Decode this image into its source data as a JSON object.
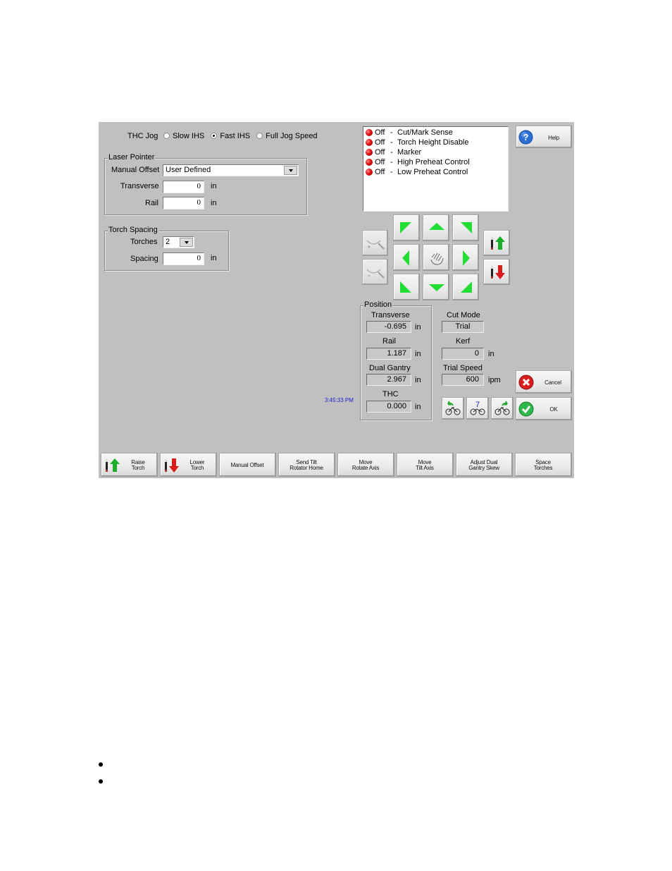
{
  "thc_jog": {
    "label": "THC Jog",
    "options": [
      {
        "label": "Slow IHS",
        "selected": false
      },
      {
        "label": "Fast IHS",
        "selected": true
      },
      {
        "label": "Full Jog Speed",
        "selected": false
      }
    ]
  },
  "laser_pointer": {
    "title": "Laser Pointer",
    "manual_offset_label": "Manual Offset",
    "manual_offset_value": "User Defined",
    "transverse_label": "Transverse",
    "transverse_value": "0",
    "transverse_unit": "in",
    "rail_label": "Rail",
    "rail_value": "0",
    "rail_unit": "in"
  },
  "torch_spacing": {
    "title": "Torch Spacing",
    "torches_label": "Torches",
    "torches_value": "2",
    "spacing_label": "Spacing",
    "spacing_value": "0",
    "spacing_unit": "in"
  },
  "status_list": [
    {
      "state": "Off",
      "sep": "-",
      "name": "Cut/Mark Sense",
      "led_color": "#e01010"
    },
    {
      "state": "Off",
      "sep": "-",
      "name": "Torch Height Disable",
      "led_color": "#e01010"
    },
    {
      "state": "Off",
      "sep": "-",
      "name": "Marker",
      "led_color": "#e01010"
    },
    {
      "state": "Off",
      "sep": "-",
      "name": "High Preheat Control",
      "led_color": "#e01010"
    },
    {
      "state": "Off",
      "sep": "-",
      "name": "Low Preheat Control",
      "led_color": "#e01010"
    }
  ],
  "help_button": {
    "label": "Help",
    "icon": "question-icon"
  },
  "cancel_button": {
    "label": "Cancel",
    "icon": "red-x-icon"
  },
  "ok_button": {
    "label": "OK",
    "icon": "green-check-icon"
  },
  "jog_pad": {
    "buttons": [
      "up-left",
      "up",
      "up-right",
      "left",
      "manual-hand",
      "right",
      "down-left",
      "down",
      "down-right"
    ],
    "arrow_color": "#22dd33"
  },
  "position": {
    "title": "Position",
    "transverse_label": "Transverse",
    "transverse_value": "-0.695",
    "rail_label": "Rail",
    "rail_value": "1.187",
    "dual_gantry_label": "Dual Gantry",
    "dual_gantry_value": "2.967",
    "thc_label": "THC",
    "thc_value": "0.000",
    "unit": "in"
  },
  "cut_mode": {
    "label": "Cut Mode",
    "value": "Trial"
  },
  "kerf": {
    "label": "Kerf",
    "value": "0",
    "unit": "in"
  },
  "trial_speed": {
    "label": "Trial Speed",
    "value": "600",
    "unit": "ipm"
  },
  "speed_buttons": {
    "middle_number": "7"
  },
  "clock": "3:45:33 PM",
  "softkeys": [
    {
      "line1": "Raise",
      "line2": "Torch"
    },
    {
      "line1": "Lower",
      "line2": "Torch"
    },
    {
      "line1": "Manual Offset",
      "line2": ""
    },
    {
      "line1": "Send Tilt",
      "line2": "Rotator Home"
    },
    {
      "line1": "Move",
      "line2": "Rotate Axis"
    },
    {
      "line1": "Move",
      "line2": "Tilt Axis"
    },
    {
      "line1": "Adjust Dual",
      "line2": "Gantry Skew"
    },
    {
      "line1": "Space",
      "line2": "Torches"
    }
  ]
}
